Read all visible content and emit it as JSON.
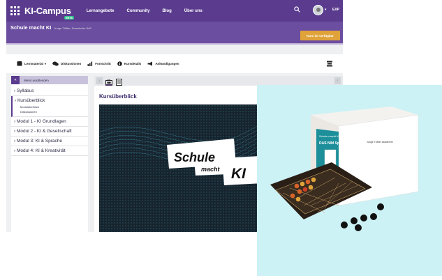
{
  "nav": {
    "logo": "KI-Campus",
    "beta": "BETA",
    "links": [
      "Lernangebote",
      "Community",
      "Blog",
      "Über uns"
    ],
    "lang": "EXP"
  },
  "course": {
    "title": "Schule macht KI",
    "subtitle": "Junge Tüftler, Fraunhofer IAIS",
    "cta": "Kurs ist verfügbar"
  },
  "toolbar": {
    "items": [
      "Lernmaterial",
      "Diskussionen",
      "Fortschritt",
      "Kursdetails",
      "Ankündigungen"
    ]
  },
  "sidebar": {
    "hide_label": "Menü ausblenden",
    "items": [
      {
        "label": "› Syllabus"
      },
      {
        "label": "› Kursüberblick",
        "active": true,
        "sub": [
          "Modulüberblick",
          "Diskussionen"
        ]
      },
      {
        "label": "› Modul 1 - KI Grundlagen"
      },
      {
        "label": "› Modul 2 - KI & Gesellschaft"
      },
      {
        "label": "› Modul 3: KI & Sprache"
      },
      {
        "label": "› Modul 4: KI & Kreativität"
      }
    ]
  },
  "main": {
    "title": "Kursüberblick"
  },
  "hero": {
    "line1": "Schule",
    "line2": "macht",
    "line3": "KI"
  },
  "product": {
    "box_label": "Schule macht KI",
    "box_title": "DAS NIM Spiel",
    "brand": "Junge Tüftler Akademie"
  },
  "colors": {
    "nav": "#5a3b8e",
    "course_bar": "#6b4ea0",
    "cta": "#e0a33a",
    "blob": "#cdf2f6"
  }
}
